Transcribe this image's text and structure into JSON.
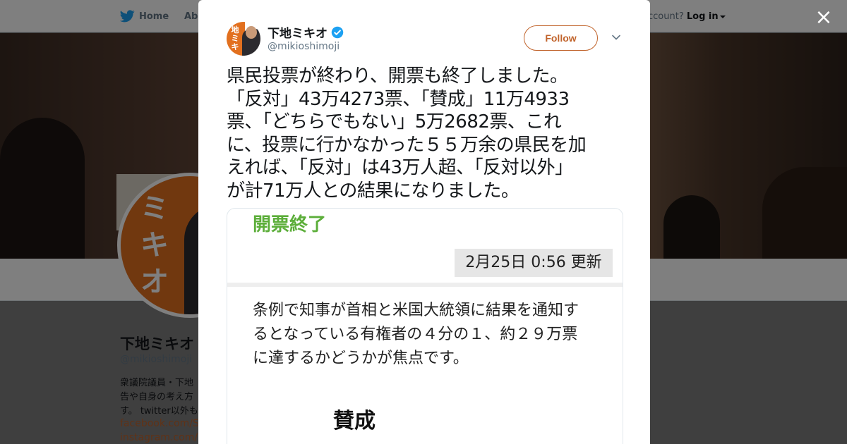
{
  "topbar": {
    "home_label": "Home",
    "about_label": "Abo",
    "account_prompt": "ccount?",
    "login_label": "Log in"
  },
  "profile": {
    "name": "下地ミキオ",
    "handle": "@mikioshimoji",
    "avatar_glyphs": "ミキオ",
    "bio_lines": [
      "衆議院議員・下地",
      "告や自身の考え方",
      "す。 twitter以外も"
    ],
    "links": [
      "facebook.com/Shi",
      "instagram.com/sh"
    ]
  },
  "modal": {
    "close_label": "×",
    "author": {
      "name": "下地ミキオ",
      "handle": "@mikioshimoji",
      "avatar_glyphs": "地ミキ"
    },
    "follow_label": "Follow",
    "tweet_lines": [
      "県民投票が終わり、開票も終了しました。",
      "「反対」43万4273票、「賛成」11万4933",
      "票、「どちらでもない」5万2682票、これ",
      "に、投票に行かなかった５５万余の県民を加",
      "えれば、「反対」は43万人超、「反対以外」",
      "が計71万人との結果になりました。"
    ],
    "media": {
      "heading": "開票終了",
      "timestamp": "2月25日 0:56 更新",
      "note_lines": [
        "条例で知事が首相と米国大統領に結果を通知す",
        "るとなっている有権者の４分の１、約２９万票",
        "に達するかどうかが焦点です。"
      ],
      "result_label": "賛成"
    }
  },
  "colors": {
    "accent": "#c1642c",
    "verified": "#1da1f2",
    "heading_green": "#5cae3a",
    "avatar_orange": "#e2701f"
  }
}
